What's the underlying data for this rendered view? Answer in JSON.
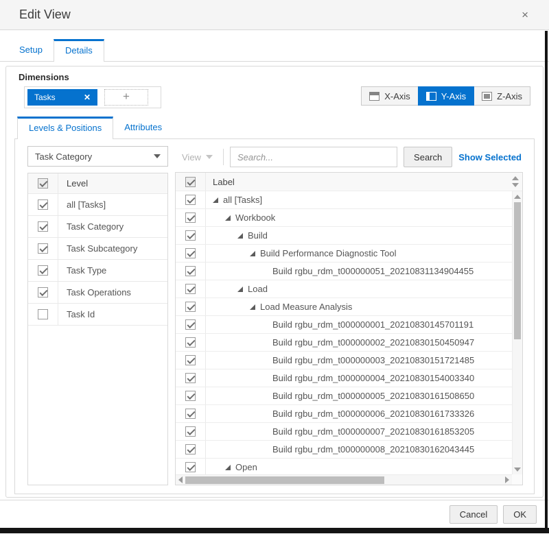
{
  "dialog": {
    "title": "Edit View",
    "close_icon": "×"
  },
  "header_tabs": {
    "setup": "Setup",
    "details": "Details"
  },
  "dimensions": {
    "section_label": "Dimensions",
    "chip_label": "Tasks",
    "chip_remove_icon": "✕",
    "add_button_label": "+"
  },
  "axis": {
    "x_label": "X-Axis",
    "y_label": "Y-Axis",
    "z_label": "Z-Axis",
    "active": "Y-Axis"
  },
  "detail_tabs": {
    "levels_positions": "Levels & Positions",
    "attributes": "Attributes"
  },
  "left_panel": {
    "level_dropdown_value": "Task Category",
    "column_header": "Level",
    "rows": [
      {
        "label": "all [Tasks]",
        "checked": true
      },
      {
        "label": "Task Category",
        "checked": true
      },
      {
        "label": "Task Subcategory",
        "checked": true
      },
      {
        "label": "Task Type",
        "checked": true
      },
      {
        "label": "Task Operations",
        "checked": true
      },
      {
        "label": "Task Id",
        "checked": false
      }
    ]
  },
  "right_panel": {
    "view_dropdown_label": "View",
    "search_placeholder": "Search...",
    "search_button_label": "Search",
    "show_selected_link": "Show Selected",
    "column_header": "Label",
    "rows": [
      {
        "label": "all [Tasks]",
        "indent": 0,
        "caret": true,
        "checked": true
      },
      {
        "label": "Workbook",
        "indent": 1,
        "caret": true,
        "checked": true
      },
      {
        "label": "Build",
        "indent": 2,
        "caret": true,
        "checked": true
      },
      {
        "label": "Build Performance Diagnostic Tool",
        "indent": 3,
        "caret": true,
        "checked": true
      },
      {
        "label": "Build rgbu_rdm_t000000051_20210831134904455",
        "indent": 4,
        "caret": false,
        "checked": true
      },
      {
        "label": "Load",
        "indent": 2,
        "caret": true,
        "checked": true
      },
      {
        "label": "Load Measure Analysis",
        "indent": 3,
        "caret": true,
        "checked": true
      },
      {
        "label": "Build rgbu_rdm_t000000001_20210830145701191",
        "indent": 4,
        "caret": false,
        "checked": true
      },
      {
        "label": "Build rgbu_rdm_t000000002_20210830150450947",
        "indent": 4,
        "caret": false,
        "checked": true
      },
      {
        "label": "Build rgbu_rdm_t000000003_20210830151721485",
        "indent": 4,
        "caret": false,
        "checked": true
      },
      {
        "label": "Build rgbu_rdm_t000000004_20210830154003340",
        "indent": 4,
        "caret": false,
        "checked": true
      },
      {
        "label": "Build rgbu_rdm_t000000005_20210830161508650",
        "indent": 4,
        "caret": false,
        "checked": true
      },
      {
        "label": "Build rgbu_rdm_t000000006_20210830161733326",
        "indent": 4,
        "caret": false,
        "checked": true
      },
      {
        "label": "Build rgbu_rdm_t000000007_20210830161853205",
        "indent": 4,
        "caret": false,
        "checked": true
      },
      {
        "label": "Build rgbu_rdm_t000000008_20210830162043445",
        "indent": 4,
        "caret": false,
        "checked": true
      },
      {
        "label": "Open",
        "indent": 1,
        "caret": true,
        "checked": true
      }
    ]
  },
  "footer": {
    "cancel_label": "Cancel",
    "ok_label": "OK"
  },
  "colors": {
    "accent": "#0572ce",
    "header_bg": "#f5f5f5",
    "border": "#d9d9d9"
  }
}
